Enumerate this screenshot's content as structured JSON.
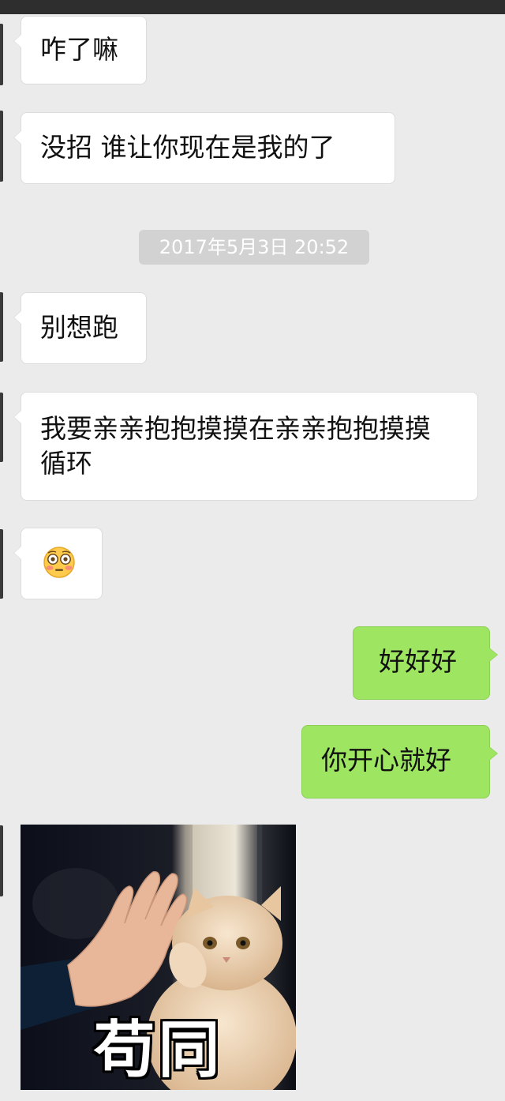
{
  "chat": {
    "messages": [
      {
        "side": "in",
        "text": "咋了嘛"
      },
      {
        "side": "in",
        "text": "没招 谁让你现在是我的了"
      },
      {
        "side": "in",
        "text": "别想跑"
      },
      {
        "side": "in",
        "text": "我要亲亲抱抱摸摸在亲亲抱抱摸摸 循环"
      },
      {
        "side": "in",
        "emoji": "flushed-face-icon"
      },
      {
        "side": "out",
        "text": "好好好"
      },
      {
        "side": "out",
        "text": "你开心就好"
      },
      {
        "side": "in",
        "sticker": "high-five-cat-sticker",
        "caption": "苟同"
      }
    ],
    "timestamp": "2017年5月3日 20:52"
  },
  "colors": {
    "background": "#ebebeb",
    "incoming_bubble": "#ffffff",
    "outgoing_bubble": "#9ee661",
    "timestamp_pill": "#d2d2d2"
  }
}
